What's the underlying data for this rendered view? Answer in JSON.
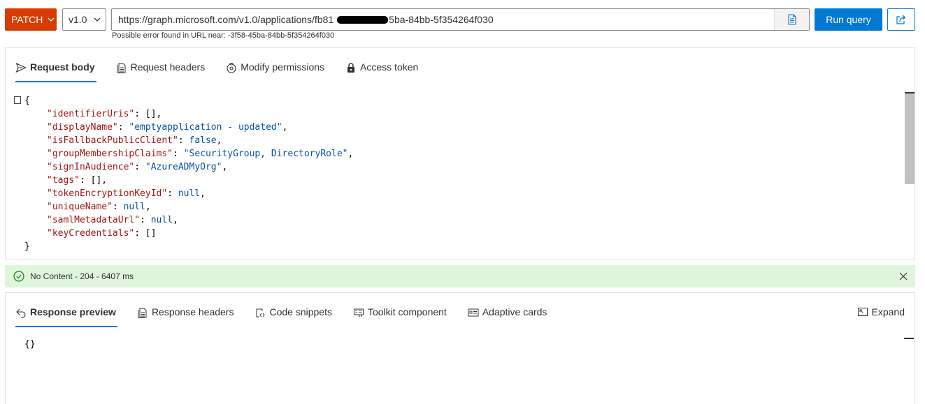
{
  "toolbar": {
    "method": "PATCH",
    "version": "v1.0",
    "url_prefix": "https://graph.microsoft.com/v1.0/applications/fb81",
    "url_suffix": "5ba-84bb-5f354264f030",
    "url_hint": "Possible error found in URL near: -3f58-45ba-84bb-5f354264f030",
    "run_label": "Run query"
  },
  "request_tabs": [
    {
      "label": "Request body",
      "icon": "send-icon",
      "active": true
    },
    {
      "label": "Request headers",
      "icon": "document-icon",
      "active": false
    },
    {
      "label": "Modify permissions",
      "icon": "shield-icon",
      "active": false
    },
    {
      "label": "Access token",
      "icon": "lock-icon",
      "active": false
    }
  ],
  "request_body": {
    "open": "{",
    "close": "}",
    "lines": [
      {
        "key": "\"identifierUris\"",
        "value": "[],",
        "kind": "plain"
      },
      {
        "key": "\"displayName\"",
        "value": "\"emptyapplication - updated\"",
        "kind": "string",
        "trail": ","
      },
      {
        "key": "\"isFallbackPublicClient\"",
        "value": "false",
        "kind": "literal",
        "trail": ","
      },
      {
        "key": "\"groupMembershipClaims\"",
        "value": "\"SecurityGroup, DirectoryRole\"",
        "kind": "string",
        "trail": ","
      },
      {
        "key": "\"signInAudience\"",
        "value": "\"AzureADMyOrg\"",
        "kind": "string",
        "trail": ","
      },
      {
        "key": "\"tags\"",
        "value": "[],",
        "kind": "plain"
      },
      {
        "key": "\"tokenEncryptionKeyId\"",
        "value": "null",
        "kind": "literal",
        "trail": ","
      },
      {
        "key": "\"uniqueName\"",
        "value": "null",
        "kind": "literal",
        "trail": ","
      },
      {
        "key": "\"samlMetadataUrl\"",
        "value": "null",
        "kind": "literal",
        "trail": ","
      },
      {
        "key": "\"keyCredentials\"",
        "value": "[]",
        "kind": "plain"
      }
    ]
  },
  "status": {
    "text": "No Content - 204 - 6407 ms",
    "color": "#dff6dd"
  },
  "response_tabs": [
    {
      "label": "Response preview",
      "icon": "undo-icon",
      "active": true
    },
    {
      "label": "Response headers",
      "icon": "document-icon",
      "active": false
    },
    {
      "label": "Code snippets",
      "icon": "code-icon",
      "active": false
    },
    {
      "label": "Toolkit component",
      "icon": "toolkit-icon",
      "active": false
    },
    {
      "label": "Adaptive cards",
      "icon": "card-icon",
      "active": false
    }
  ],
  "expand_label": "Expand",
  "response_body": "{}",
  "colors": {
    "method": "#d83b01",
    "accent": "#0078d4"
  }
}
